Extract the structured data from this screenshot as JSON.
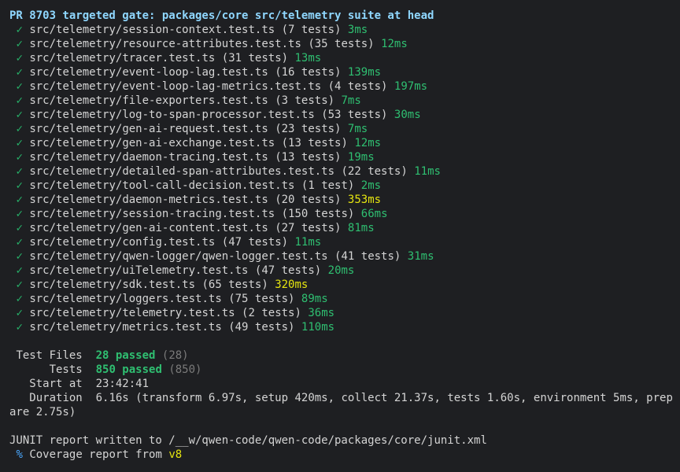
{
  "title": "PR 8703 targeted gate: packages/core src/telemetry suite at head",
  "check_glyph": "✓",
  "tests": [
    {
      "path": "src/telemetry/session-context.test.ts",
      "count": "(7 tests)",
      "time": "3ms",
      "slow": false
    },
    {
      "path": "src/telemetry/resource-attributes.test.ts",
      "count": "(35 tests)",
      "time": "12ms",
      "slow": false
    },
    {
      "path": "src/telemetry/tracer.test.ts",
      "count": "(31 tests)",
      "time": "13ms",
      "slow": false
    },
    {
      "path": "src/telemetry/event-loop-lag.test.ts",
      "count": "(16 tests)",
      "time": "139ms",
      "slow": false
    },
    {
      "path": "src/telemetry/event-loop-lag-metrics.test.ts",
      "count": "(4 tests)",
      "time": "197ms",
      "slow": false
    },
    {
      "path": "src/telemetry/file-exporters.test.ts",
      "count": "(3 tests)",
      "time": "7ms",
      "slow": false
    },
    {
      "path": "src/telemetry/log-to-span-processor.test.ts",
      "count": "(53 tests)",
      "time": "30ms",
      "slow": false
    },
    {
      "path": "src/telemetry/gen-ai-request.test.ts",
      "count": "(23 tests)",
      "time": "7ms",
      "slow": false
    },
    {
      "path": "src/telemetry/gen-ai-exchange.test.ts",
      "count": "(13 tests)",
      "time": "12ms",
      "slow": false
    },
    {
      "path": "src/telemetry/daemon-tracing.test.ts",
      "count": "(13 tests)",
      "time": "19ms",
      "slow": false
    },
    {
      "path": "src/telemetry/detailed-span-attributes.test.ts",
      "count": "(22 tests)",
      "time": "11ms",
      "slow": false
    },
    {
      "path": "src/telemetry/tool-call-decision.test.ts",
      "count": "(1 test)",
      "time": "2ms",
      "slow": false
    },
    {
      "path": "src/telemetry/daemon-metrics.test.ts",
      "count": "(20 tests)",
      "time": "353ms",
      "slow": true
    },
    {
      "path": "src/telemetry/session-tracing.test.ts",
      "count": "(150 tests)",
      "time": "66ms",
      "slow": false
    },
    {
      "path": "src/telemetry/gen-ai-content.test.ts",
      "count": "(27 tests)",
      "time": "81ms",
      "slow": false
    },
    {
      "path": "src/telemetry/config.test.ts",
      "count": "(47 tests)",
      "time": "11ms",
      "slow": false
    },
    {
      "path": "src/telemetry/qwen-logger/qwen-logger.test.ts",
      "count": "(41 tests)",
      "time": "31ms",
      "slow": false
    },
    {
      "path": "src/telemetry/uiTelemetry.test.ts",
      "count": "(47 tests)",
      "time": "20ms",
      "slow": false
    },
    {
      "path": "src/telemetry/sdk.test.ts",
      "count": "(65 tests)",
      "time": "320ms",
      "slow": true
    },
    {
      "path": "src/telemetry/loggers.test.ts",
      "count": "(75 tests)",
      "time": "89ms",
      "slow": false
    },
    {
      "path": "src/telemetry/telemetry.test.ts",
      "count": "(2 tests)",
      "time": "36ms",
      "slow": false
    },
    {
      "path": "src/telemetry/metrics.test.ts",
      "count": "(49 tests)",
      "time": "110ms",
      "slow": false
    }
  ],
  "summary": {
    "test_files_label": "Test Files",
    "test_files_passed": "28 passed",
    "test_files_total": "(28)",
    "tests_label": "Tests",
    "tests_passed": "850 passed",
    "tests_total": "(850)",
    "start_label": "Start at",
    "start_value": "23:42:41",
    "duration_label": "Duration",
    "duration_value": "6.16s (transform 6.97s, setup 420ms, collect 21.37s, tests 1.60s, environment 5ms, prep",
    "duration_wrap": "are 2.75s)"
  },
  "junit_line": "JUNIT report written to /__w/qwen-code/qwen-code/packages/core/junit.xml",
  "coverage": {
    "glyph": "%",
    "text": "Coverage report from",
    "provider": "v8"
  },
  "colors": {
    "background": "#1e1f22",
    "title": "#8fd7ff",
    "pass": "#2fbf71",
    "slow": "#e5e510",
    "dim": "#7a7a7a"
  }
}
